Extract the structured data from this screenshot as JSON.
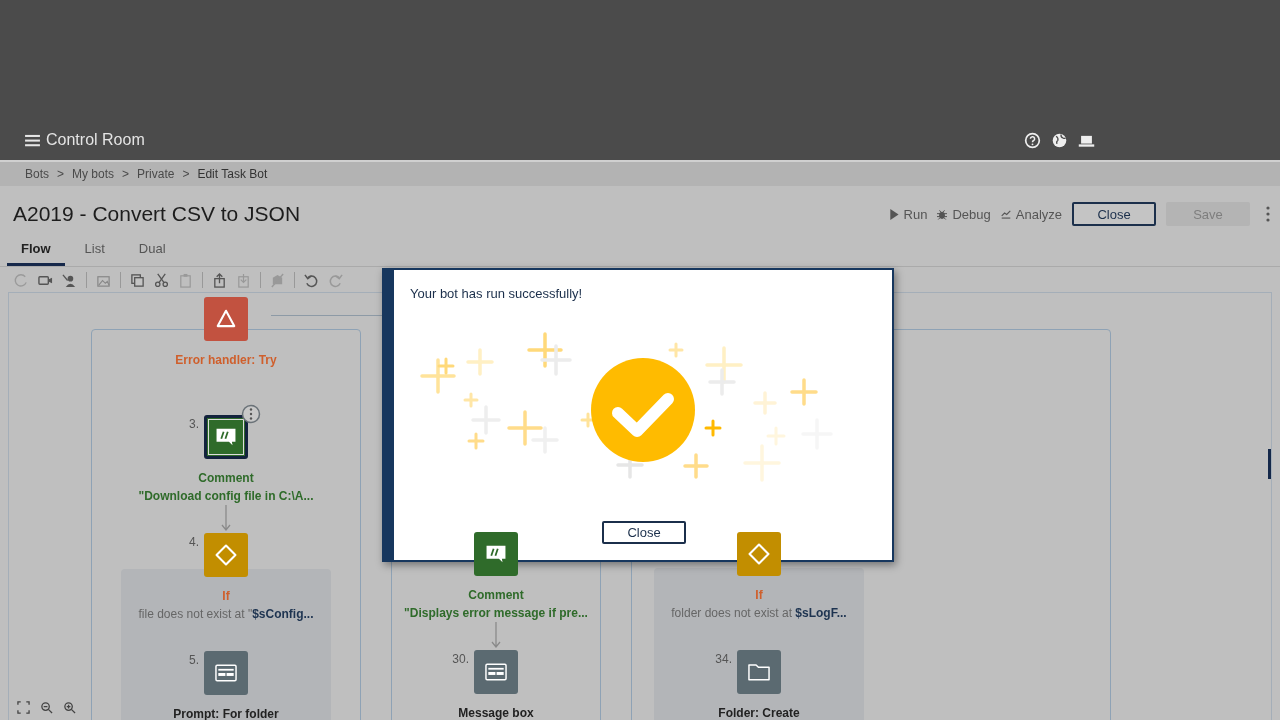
{
  "header": {
    "title": "Control Room"
  },
  "breadcrumb": {
    "separator": ">",
    "items": [
      {
        "label": "Bots"
      },
      {
        "label": "My bots"
      },
      {
        "label": "Private"
      },
      {
        "label": "Edit Task Bot"
      }
    ]
  },
  "bot_title": "A2019 - Convert CSV to JSON",
  "actions": [
    {
      "kind": "run",
      "label": "Run"
    },
    {
      "kind": "debug",
      "label": "Debug"
    },
    {
      "kind": "analyze",
      "label": "Analyze"
    }
  ],
  "buttons": [
    {
      "label": "Close",
      "disabled": false
    },
    {
      "label": "Save",
      "disabled": true
    }
  ],
  "tabs": [
    {
      "label": "Flow",
      "selected": true
    },
    {
      "label": "List",
      "selected": false
    },
    {
      "label": "Dual",
      "selected": false
    }
  ],
  "flow": {
    "columns": [
      {
        "nodes": [
          {
            "kind": "error",
            "title": "Error handler: Try",
            "selected": false
          },
          {
            "kind": "comment",
            "number": "3.",
            "title": "Comment",
            "subtitle": "\"Download config file in C:\\A...",
            "selected": true,
            "arrow_below": true
          },
          {
            "kind": "if",
            "number": "4.",
            "title": "If",
            "subtitle": "file does not exist at \"**$sConfig...**",
            "selected": false,
            "children": [
              {
                "kind": "prompt",
                "number": "5.",
                "title": "Prompt: For folder",
                "selected": false
              }
            ]
          }
        ]
      },
      {
        "nodes": [
          {
            "kind": "comment",
            "title": "Comment",
            "subtitle": "\"Displays error message if pre...",
            "selected": false,
            "arrow_below": true
          },
          {
            "kind": "message",
            "number": "30.",
            "title": "Message box",
            "selected": false
          }
        ]
      },
      {
        "nodes": [
          {
            "kind": "if",
            "title": "If",
            "subtitle": "folder does not exist at **$sLogF...**",
            "selected": false,
            "children": [
              {
                "kind": "folder",
                "number": "34.",
                "title": "Folder: Create",
                "selected": false
              }
            ]
          }
        ]
      }
    ]
  },
  "dialog": {
    "message": "Your bot has run successfully!",
    "button": "Close"
  }
}
